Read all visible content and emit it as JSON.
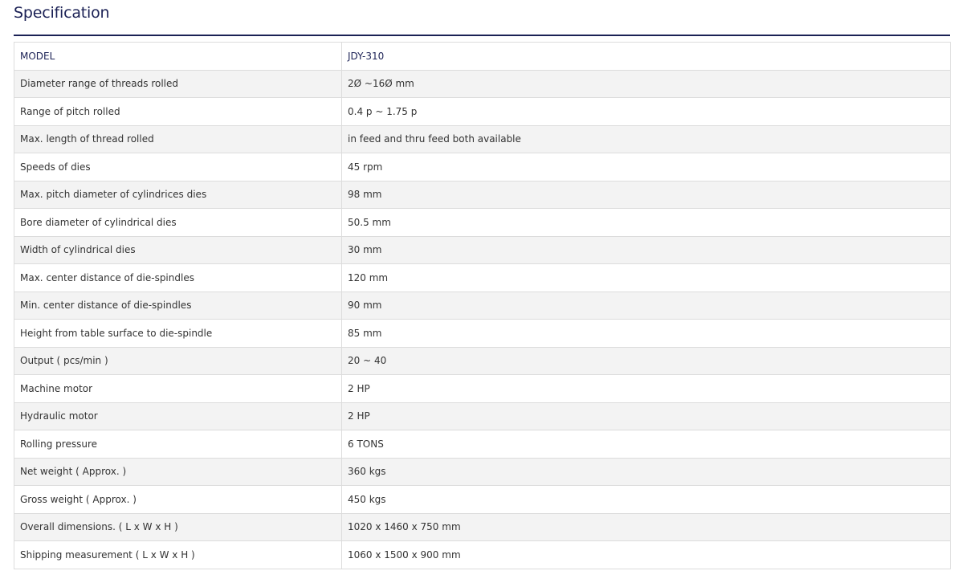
{
  "page": {
    "title": "Specification"
  },
  "spec_table": {
    "rows": [
      {
        "label": "MODEL",
        "value": "JDY-310"
      },
      {
        "label": "Diameter range of threads rolled",
        "value": "2Ø ~16Ø mm"
      },
      {
        "label": "Range of pitch rolled",
        "value": "0.4 p ~ 1.75 p"
      },
      {
        "label": "Max. length of thread rolled",
        "value": "in feed and thru feed both available"
      },
      {
        "label": "Speeds of dies",
        "value": "45 rpm"
      },
      {
        "label": "Max. pitch diameter of cylindrices dies",
        "value": "98 mm"
      },
      {
        "label": "Bore diameter of cylindrical dies",
        "value": "50.5 mm"
      },
      {
        "label": "Width of cylindrical dies",
        "value": "30 mm"
      },
      {
        "label": "Max. center distance of die-spindles",
        "value": "120 mm"
      },
      {
        "label": "Min. center distance of die-spindles",
        "value": "90 mm"
      },
      {
        "label": "Height from table surface to die-spindle",
        "value": "85 mm"
      },
      {
        "label": "Output ( pcs/min )",
        "value": "20 ~ 40"
      },
      {
        "label": "Machine motor",
        "value": "2 HP"
      },
      {
        "label": "Hydraulic motor",
        "value": "2 HP"
      },
      {
        "label": "Rolling pressure",
        "value": "6 TONS"
      },
      {
        "label": "Net weight ( Approx. )",
        "value": "360 kgs"
      },
      {
        "label": "Gross weight ( Approx. )",
        "value": "450 kgs"
      },
      {
        "label": "Overall dimensions. ( L x W x H )",
        "value": "1020 x 1460 x 750 mm"
      },
      {
        "label": "Shipping measurement ( L x W x H )",
        "value": "1060 x 1500 x 900 mm"
      }
    ]
  },
  "colors": {
    "heading": "#1b2155",
    "text": "#333333",
    "row_alt": "#f3f3f3",
    "border": "#dcdcdc"
  }
}
